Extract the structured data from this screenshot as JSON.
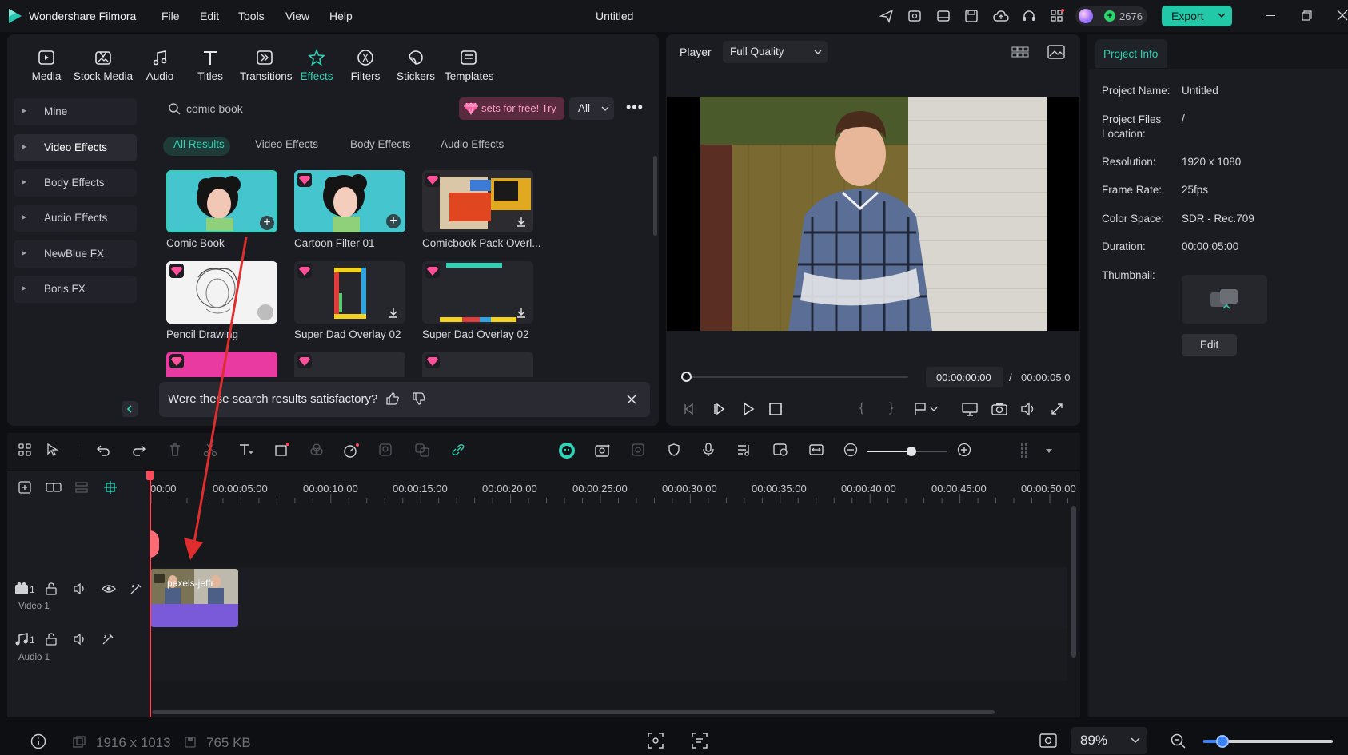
{
  "app": {
    "name": "Wondershare Filmora",
    "doc_title": "Untitled",
    "credits": "2676",
    "export_label": "Export"
  },
  "menu": [
    "File",
    "Edit",
    "Tools",
    "View",
    "Help"
  ],
  "toolbar": [
    {
      "label": "Media",
      "icon": "media-icon"
    },
    {
      "label": "Stock Media",
      "icon": "stock-media-icon"
    },
    {
      "label": "Audio",
      "icon": "audio-icon"
    },
    {
      "label": "Titles",
      "icon": "titles-icon"
    },
    {
      "label": "Transitions",
      "icon": "transitions-icon"
    },
    {
      "label": "Effects",
      "icon": "effects-icon",
      "active": true
    },
    {
      "label": "Filters",
      "icon": "filters-icon"
    },
    {
      "label": "Stickers",
      "icon": "stickers-icon"
    },
    {
      "label": "Templates",
      "icon": "templates-icon"
    }
  ],
  "categories": [
    "Mine",
    "Video Effects",
    "Body Effects",
    "Audio Effects",
    "NewBlue FX",
    "Boris FX"
  ],
  "search": {
    "value": "comic book",
    "promo": "sets for free! Try",
    "filter": "All"
  },
  "filter_tabs": [
    "All Results",
    "Video Effects",
    "Body Effects",
    "Audio Effects"
  ],
  "results": [
    "Comic Book",
    "Cartoon Filter 01",
    "Comicbook Pack Overl...",
    "Pencil Drawing",
    "Super Dad Overlay 02",
    "Super Dad Overlay 02"
  ],
  "feedback": {
    "question": "Were these search results satisfactory?"
  },
  "player": {
    "label": "Player",
    "quality": "Full Quality",
    "time_current": "00:00:00:00",
    "time_sep": "/",
    "time_total": "00:00:05:0"
  },
  "project_info": {
    "tab": "Project Info",
    "rows": [
      {
        "label": "Project Name:",
        "value": "Untitled"
      },
      {
        "label": "Project Files Location:",
        "value": "/"
      },
      {
        "label": "Resolution:",
        "value": "1920 x 1080"
      },
      {
        "label": "Frame Rate:",
        "value": "25fps"
      },
      {
        "label": "Color Space:",
        "value": "SDR - Rec.709"
      },
      {
        "label": "Duration:",
        "value": "00:00:05:00"
      },
      {
        "label": "Thumbnail:",
        "value": ""
      }
    ],
    "edit_label": "Edit"
  },
  "timeline": {
    "ticks": [
      "00:00",
      "00:00:05:00",
      "00:00:10:00",
      "00:00:15:00",
      "00:00:20:00",
      "00:00:25:00",
      "00:00:30:00",
      "00:00:35:00",
      "00:00:40:00",
      "00:00:45:00",
      "00:00:50:00"
    ],
    "tracks": [
      {
        "num": "1",
        "name": "Video 1"
      },
      {
        "num": "1",
        "name": "Audio 1"
      }
    ],
    "clip_name": "pexels-jeffr",
    "zoom_level": 0.55
  },
  "status": {
    "dimensions": "1916 x 1013",
    "size": "765 KB",
    "zoom": "89%"
  },
  "colors": {
    "accent": "#2ed3b7",
    "export": "#22c9a9",
    "playhead": "#ff4a5a",
    "clip": "#7a5ad8",
    "arrow": "#e02d2d"
  }
}
